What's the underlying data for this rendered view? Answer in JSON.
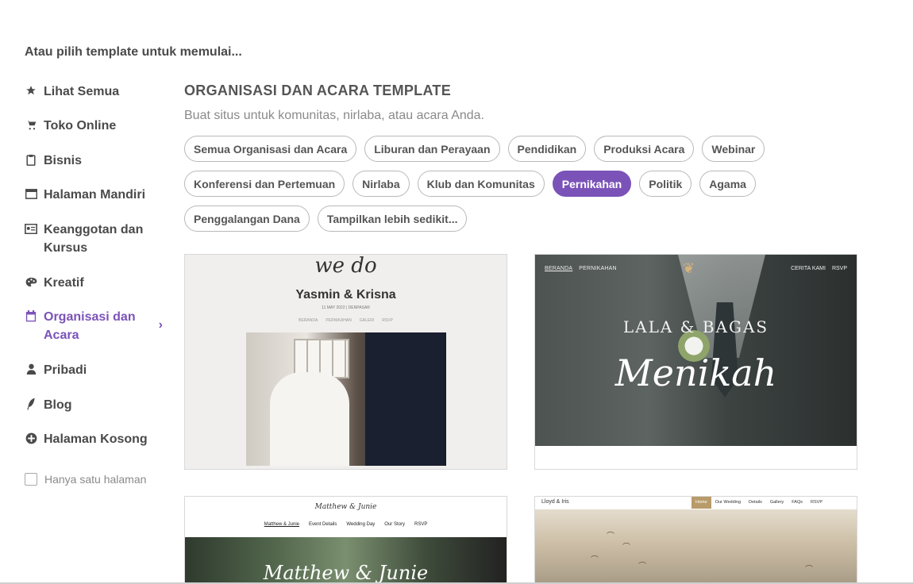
{
  "intro": "Atau pilih template untuk memulai...",
  "sidebar": {
    "items": [
      {
        "label": "Lihat Semua",
        "icon": "star-icon"
      },
      {
        "label": "Toko Online",
        "icon": "cart-icon"
      },
      {
        "label": "Bisnis",
        "icon": "clipboard-icon"
      },
      {
        "label": "Halaman Mandiri",
        "icon": "window-icon"
      },
      {
        "label": "Keanggotan dan Kursus",
        "icon": "id-card-icon"
      },
      {
        "label": "Kreatif",
        "icon": "palette-icon"
      },
      {
        "label": "Organisasi dan Acara",
        "icon": "calendar-icon",
        "active": true
      },
      {
        "label": "Pribadi",
        "icon": "person-icon"
      },
      {
        "label": "Blog",
        "icon": "quill-icon"
      },
      {
        "label": "Halaman Kosong",
        "icon": "plus-circle-icon"
      }
    ],
    "checkbox_label": "Hanya satu halaman"
  },
  "section": {
    "title": "ORGANISASI DAN ACARA TEMPLATE",
    "subtitle": "Buat situs untuk komunitas, nirlaba, atau acara Anda."
  },
  "chips": [
    "Semua Organisasi dan Acara",
    "Liburan dan Perayaan",
    "Pendidikan",
    "Produksi Acara",
    "Webinar",
    "Konferensi dan Pertemuan",
    "Nirlaba",
    "Klub dan Komunitas",
    "Pernikahan",
    "Politik",
    "Agama",
    "Penggalangan Dana",
    "Tampilkan lebih sedikit..."
  ],
  "active_chip": "Pernikahan",
  "accent_color": "#7b53b8",
  "templates": {
    "t1": {
      "script": "we do",
      "names": "Yasmin & Krisna",
      "date": "11 MAY 2022 | DENPASAR",
      "nav": [
        "BERANDA",
        "PERNIKAHAN",
        "GALERI",
        "RSVP"
      ]
    },
    "t2": {
      "nav_left": [
        "BERANDA",
        "PERNIKAHAN"
      ],
      "nav_right": [
        "CERITA KAMI",
        "RSVP"
      ],
      "couple": "LALA & BAGAS",
      "big": "Menikah"
    },
    "t3": {
      "script": "Matthew & Junie",
      "nav": [
        "Matthew & Junie",
        "Event Details",
        "Wedding Day",
        "Our Story",
        "RSVP"
      ],
      "big": "Matthew & Junie"
    },
    "t4": {
      "brand": "Lloyd & Iris",
      "nav": [
        "Home",
        "Our Wedding",
        "Details",
        "Gallery",
        "FAQs",
        "RSVP"
      ]
    }
  }
}
